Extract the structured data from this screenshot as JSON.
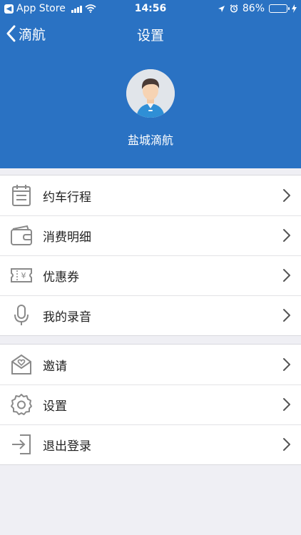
{
  "status_bar": {
    "back_app": "App Store",
    "time": "14:56",
    "battery": "86%"
  },
  "nav": {
    "back_label": "滴航",
    "title": "设置"
  },
  "profile": {
    "name": "盐城滴航"
  },
  "menu_group_1": [
    {
      "label": "约车行程",
      "icon": "calendar-icon"
    },
    {
      "label": "消费明细",
      "icon": "wallet-icon"
    },
    {
      "label": "优惠券",
      "icon": "coupon-icon"
    },
    {
      "label": "我的录音",
      "icon": "microphone-icon"
    }
  ],
  "menu_group_2": [
    {
      "label": "邀请",
      "icon": "invite-envelope-icon"
    },
    {
      "label": "设置",
      "icon": "gear-icon"
    },
    {
      "label": "退出登录",
      "icon": "logout-icon"
    }
  ],
  "colors": {
    "header_bg": "#2a72c3",
    "page_bg": "#efeff4",
    "icon_gray": "#8a8a8a"
  }
}
